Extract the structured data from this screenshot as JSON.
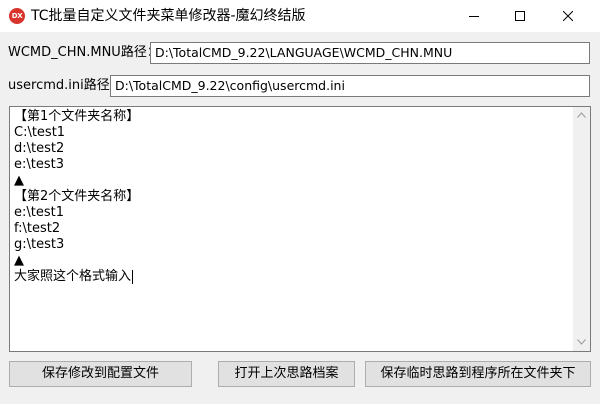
{
  "window": {
    "icon_text": "DX",
    "title": "TC批量自定义文件夹菜单修改器-魔幻终结版"
  },
  "fields": {
    "mnu_label": "WCMD_CHN.MNU路径：",
    "mnu_value": "D:\\TotalCMD_9.22\\LANGUAGE\\WCMD_CHN.MNU",
    "ini_label": "usercmd.ini路径：",
    "ini_value": "D:\\TotalCMD_9.22\\config\\usercmd.ini"
  },
  "memo": {
    "lines": [
      "【第1个文件夹名称】",
      "C:\\test1",
      "d:\\test2",
      "e:\\test3",
      "▲",
      "【第2个文件夹名称】",
      "e:\\test1",
      "f:\\test2",
      "g:\\test3",
      "▲",
      "大家照这个格式输入"
    ]
  },
  "buttons": {
    "save_config": "保存修改到配置文件",
    "open_last": "打开上次思路档案",
    "save_temp": "保存临时思路到程序所在文件夹下"
  },
  "icons": {
    "app": "app-logo-icon",
    "minimize": "minimize-icon",
    "maximize": "maximize-icon",
    "close": "close-icon",
    "scroll_up": "chevron-up-icon",
    "scroll_down": "chevron-down-icon"
  },
  "colors": {
    "app_icon": "#d9342b",
    "window_bg": "#f0f0f0",
    "button_bg": "#e1e1e1"
  }
}
